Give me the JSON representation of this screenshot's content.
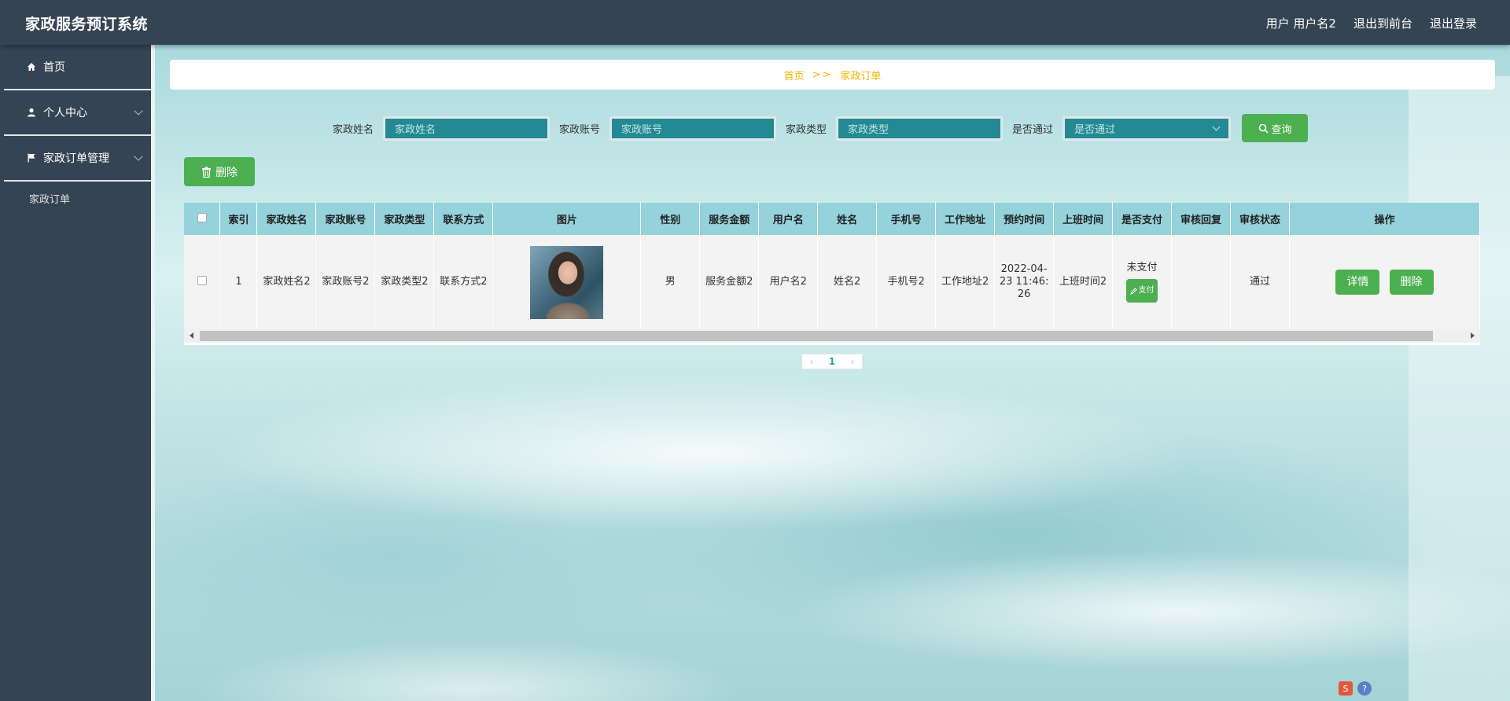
{
  "header": {
    "title": "家政服务预订系统",
    "user_text": "用户 用户名2",
    "to_front": "退出到前台",
    "logout": "退出登录"
  },
  "sidebar": {
    "items": [
      {
        "label": "首页",
        "icon": "home-icon"
      },
      {
        "label": "个人中心",
        "icon": "user-icon"
      },
      {
        "label": "家政订单管理",
        "icon": "flag-icon"
      }
    ],
    "sub_item": "家政订单"
  },
  "breadcrumb": {
    "home": "首页",
    "sep": ">>",
    "current": "家政订单"
  },
  "search": {
    "f1_label": "家政姓名",
    "f1_placeholder": "家政姓名",
    "f2_label": "家政账号",
    "f2_placeholder": "家政账号",
    "f3_label": "家政类型",
    "f3_placeholder": "家政类型",
    "f4_label": "是否通过",
    "f4_placeholder": "是否通过",
    "query_label": "查询"
  },
  "toolbar": {
    "delete_label": "删除"
  },
  "table": {
    "headers": [
      "索引",
      "家政姓名",
      "家政账号",
      "家政类型",
      "联系方式",
      "图片",
      "性别",
      "服务金额",
      "用户名",
      "姓名",
      "手机号",
      "工作地址",
      "预约时间",
      "上班时间",
      "是否支付",
      "审核回复",
      "审核状态",
      "操作"
    ],
    "row": {
      "index": "1",
      "name": "家政姓名2",
      "account": "家政账号2",
      "type": "家政类型2",
      "contact": "联系方式2",
      "gender": "男",
      "amount": "服务金额2",
      "username": "用户名2",
      "realname": "姓名2",
      "phone": "手机号2",
      "address": "工作地址2",
      "appoint_time": "2022-04-23 11:46:26",
      "work_time": "上班时间2",
      "paid": "未支付",
      "pay_btn": "支付",
      "review_reply": "",
      "review_status": "通过",
      "detail_btn": "详情",
      "delete_btn": "删除"
    }
  },
  "pager": {
    "current": "1",
    "prev": "‹",
    "next": "›"
  },
  "colors": {
    "header_bg": "#354453",
    "accent_green": "#4caf50",
    "table_header": "#94d3db",
    "input_bg": "#238a93",
    "breadcrumb_text": "#f0b400"
  }
}
